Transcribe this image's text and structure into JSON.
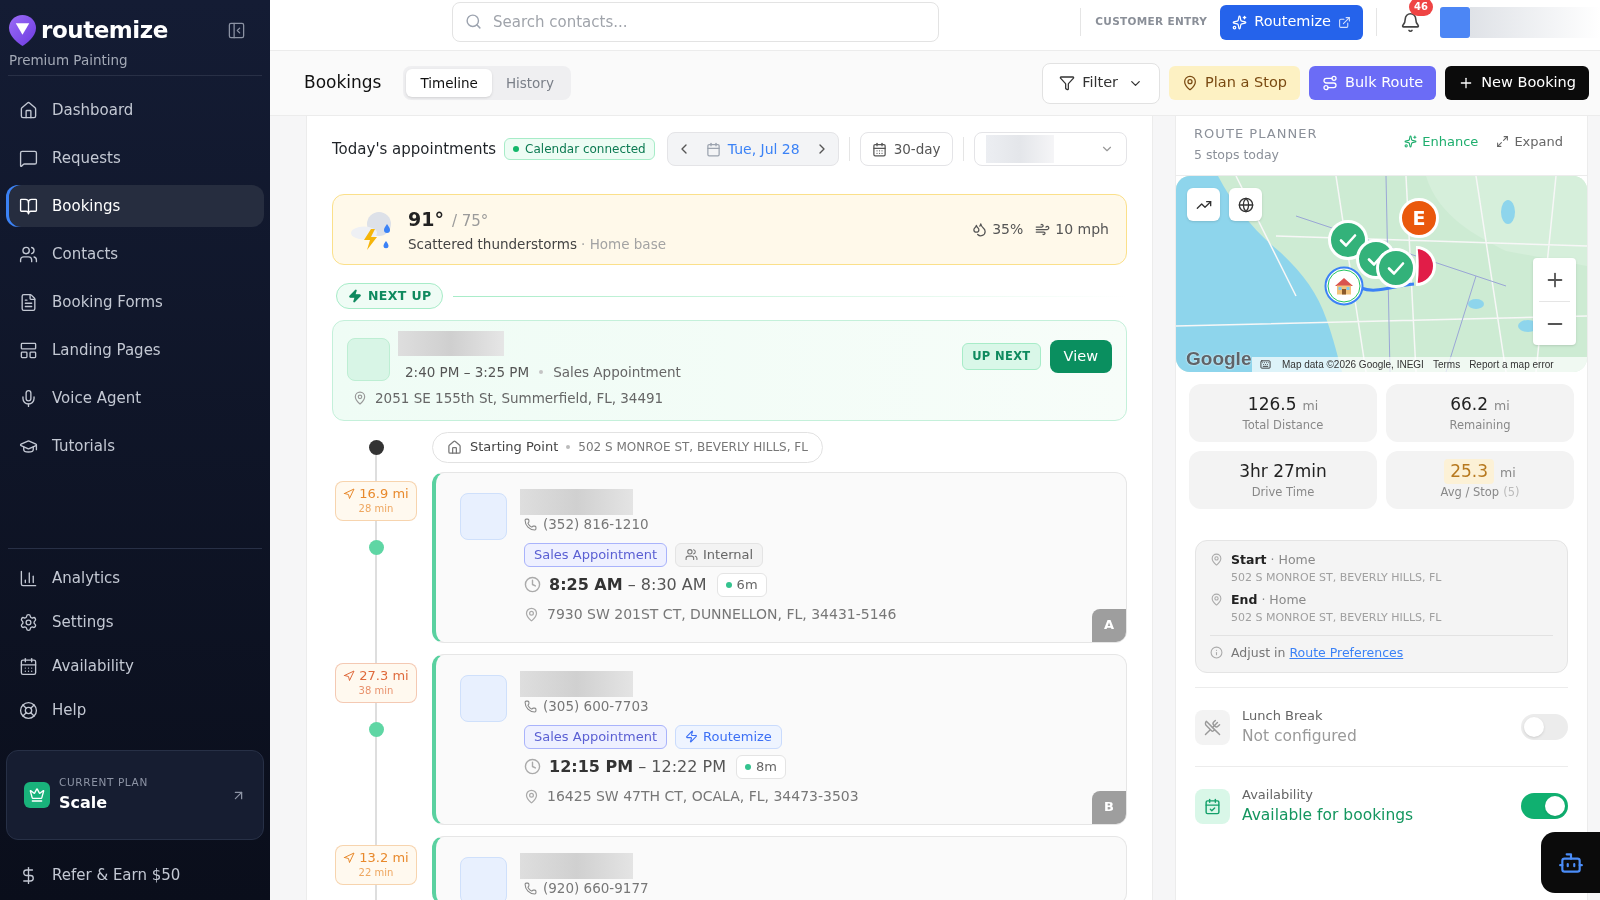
{
  "sidebar": {
    "brand": "routemize",
    "workspace": "Premium Painting",
    "nav": [
      {
        "label": "Dashboard",
        "selected": false
      },
      {
        "label": "Requests",
        "selected": false
      },
      {
        "label": "Bookings",
        "selected": true
      },
      {
        "label": "Contacts",
        "selected": false
      },
      {
        "label": "Booking Forms",
        "selected": false
      },
      {
        "label": "Landing Pages",
        "selected": false
      },
      {
        "label": "Voice Agent",
        "selected": false
      },
      {
        "label": "Tutorials",
        "selected": false
      }
    ],
    "secondary_nav": [
      {
        "label": "Analytics",
        "selected": false
      },
      {
        "label": "Settings",
        "selected": false
      },
      {
        "label": "Availability",
        "selected": false
      },
      {
        "label": "Help",
        "selected": false
      }
    ],
    "plan": {
      "caption": "CURRENT PLAN",
      "name": "Scale"
    },
    "referral": "Refer & Earn $50"
  },
  "top_bar": {
    "search": {
      "placeholder": "Search contacts..."
    },
    "mode_label": "CUSTOMER ENTRY",
    "app_button": "Routemize",
    "notification_count": "46"
  },
  "header": {
    "title": "Bookings",
    "tabs": [
      {
        "label": "Timeline",
        "selected": true
      },
      {
        "label": "History",
        "selected": false
      }
    ],
    "actions": [
      {
        "kind": "filter",
        "label": "Filter"
      },
      {
        "kind": "plan",
        "label": "Plan a Stop"
      },
      {
        "kind": "bulk",
        "label": "Bulk Route"
      },
      {
        "kind": "new",
        "label": "New Booking"
      }
    ]
  },
  "appointments": {
    "title": "Today's appointments",
    "calendar_status": "Calendar connected",
    "date": "Tue, Jul 28",
    "range": "30-day",
    "weather": {
      "high": "91°",
      "low": "/ 75°",
      "condition": "Scattered thunderstorms",
      "location": "· Home base",
      "precipitation": "35%",
      "wind": "10 mph"
    },
    "next_up": {
      "label": "NEXT UP",
      "time": "2:40 PM – 3:25 PM",
      "type": "Sales Appointment",
      "address": "2051 SE 155th St, Summerfield, FL, 34491",
      "badge": "UP NEXT",
      "action": "View"
    },
    "start": {
      "label": "Starting Point",
      "address": "502 S MONROE ST, BEVERLY HILLS, FL"
    },
    "stops": [
      {
        "leg": {
          "distance": "16.9 mi",
          "duration": "28 min",
          "color": "#e8892c"
        },
        "phone": "(352) 816-1210",
        "tags": [
          {
            "kind": "type",
            "label": "Sales Appointment"
          },
          {
            "kind": "internal",
            "label": "Internal"
          }
        ],
        "time": "**8:25 AM** – 8:30 AM",
        "duration": "6m",
        "address": "7930 SW 201ST CT, DUNNELLON, FL, 34431-5146",
        "letter": "A"
      },
      {
        "leg": {
          "distance": "27.3 mi",
          "duration": "38 min",
          "color": "#df6a3c"
        },
        "phone": "(305) 600-7703",
        "tags": [
          {
            "kind": "type",
            "label": "Sales Appointment"
          },
          {
            "kind": "source",
            "label": "Routemize"
          }
        ],
        "time": "**12:15 PM** – 12:22 PM",
        "duration": "8m",
        "address": "16425 SW 47TH CT, OCALA, FL, 34473-3503",
        "letter": "B"
      },
      {
        "leg": {
          "distance": "13.2 mi",
          "duration": "22 min",
          "color": "#e8892c"
        },
        "phone": "(920) 660-9177"
      }
    ]
  },
  "route_planner": {
    "title": "ROUTE PLANNER",
    "subtitle": "5 stops today",
    "actions": [
      {
        "kind": "enhance",
        "label": "Enhance"
      },
      {
        "kind": "expand",
        "label": "Expand"
      }
    ],
    "map": {
      "markers": [
        {
          "kind": "check"
        },
        {
          "kind": "check"
        },
        {
          "kind": "stop"
        },
        {
          "kind": "check"
        },
        {
          "kind": "home"
        },
        {
          "kind": "letter",
          "label": "E"
        }
      ],
      "logo": "Google",
      "attribution": "Map data ©2026 Google, INEGI",
      "links": [
        "Terms",
        "Report a map error"
      ]
    },
    "stats": [
      {
        "value": "126.5",
        "unit": "mi",
        "label": "Total Distance",
        "highlighted": false
      },
      {
        "value": "66.2",
        "unit": "mi",
        "label": "Remaining",
        "highlighted": false
      },
      {
        "value": "3hr 27min",
        "label": "Drive Time",
        "highlighted": false
      },
      {
        "value": "25.3",
        "unit": "mi",
        "label": "Avg / Stop",
        "note": "(5)",
        "highlighted": true
      }
    ],
    "endpoints": [
      {
        "label": "Start",
        "place": "· Home",
        "address": "502 S MONROE ST, BEVERLY HILLS, FL"
      },
      {
        "label": "End",
        "place": "· Home",
        "address": "502 S MONROE ST, BEVERLY HILLS, FL"
      }
    ],
    "hint": {
      "text": "Adjust in",
      "link": "Route Preferences"
    },
    "settings": [
      {
        "kind": "lunch",
        "title": "Lunch Break",
        "status": "Not configured",
        "on": false
      },
      {
        "kind": "availability",
        "title": "Availability",
        "status": "Available for bookings",
        "on": true
      }
    ]
  }
}
